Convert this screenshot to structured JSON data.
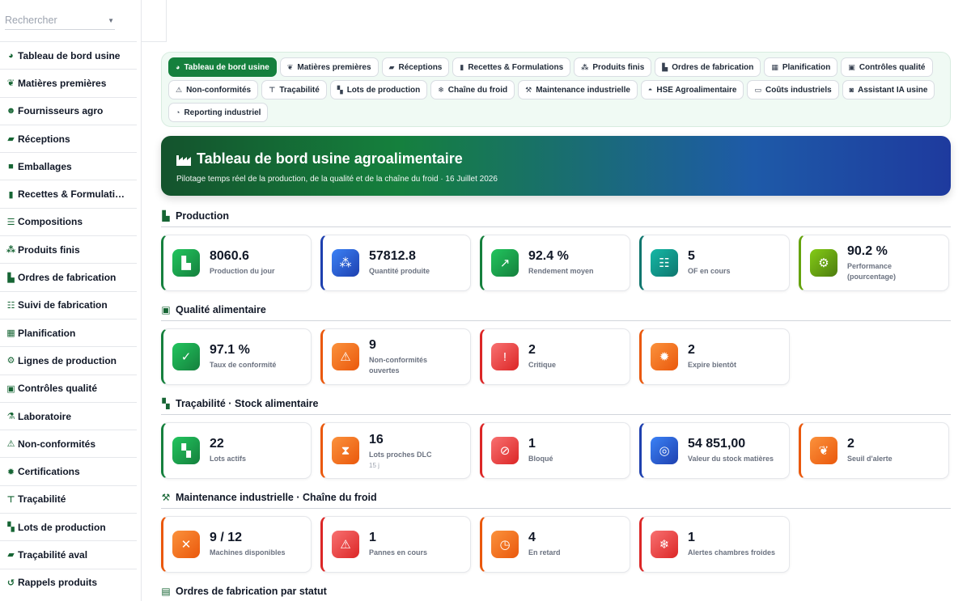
{
  "search": {
    "placeholder": "Rechercher"
  },
  "sidebar": {
    "items": [
      {
        "label": "Tableau de bord usine",
        "icon": "gauge-icon"
      },
      {
        "label": "Matières premières",
        "icon": "seedling-icon"
      },
      {
        "label": "Fournisseurs agro",
        "icon": "users-icon"
      },
      {
        "label": "Réceptions",
        "icon": "truck-icon"
      },
      {
        "label": "Emballages",
        "icon": "box-icon"
      },
      {
        "label": "Recettes & Formulati…",
        "icon": "book-icon"
      },
      {
        "label": "Compositions",
        "icon": "list-icon"
      },
      {
        "label": "Produits finis",
        "icon": "cubes-icon"
      },
      {
        "label": "Ordres de fabrication",
        "icon": "industry-icon"
      },
      {
        "label": "Suivi de fabrication",
        "icon": "list-check-icon"
      },
      {
        "label": "Planification",
        "icon": "calendar-icon"
      },
      {
        "label": "Lignes de production",
        "icon": "gears-icon"
      },
      {
        "label": "Contrôles qualité",
        "icon": "clipboard-check-icon"
      },
      {
        "label": "Laboratoire",
        "icon": "flask-icon"
      },
      {
        "label": "Non-conformités",
        "icon": "warning-icon"
      },
      {
        "label": "Certifications",
        "icon": "certificate-icon"
      },
      {
        "label": "Traçabilité",
        "icon": "sitemap-icon"
      },
      {
        "label": "Lots de production",
        "icon": "boxes-icon"
      },
      {
        "label": "Traçabilité aval",
        "icon": "truck-fast-icon"
      },
      {
        "label": "Rappels produits",
        "icon": "rotate-left-icon"
      }
    ]
  },
  "tabs": [
    {
      "label": "Tableau de bord usine",
      "active": true
    },
    {
      "label": "Matières premières"
    },
    {
      "label": "Réceptions"
    },
    {
      "label": "Recettes & Formulations"
    },
    {
      "label": "Produits finis"
    },
    {
      "label": "Ordres de fabrication"
    },
    {
      "label": "Planification"
    },
    {
      "label": "Contrôles qualité"
    },
    {
      "label": "Non-conformités"
    },
    {
      "label": "Traçabilité"
    },
    {
      "label": "Lots de production"
    },
    {
      "label": "Chaîne du froid"
    },
    {
      "label": "Maintenance industrielle"
    },
    {
      "label": "HSE Agroalimentaire"
    },
    {
      "label": "Coûts industriels"
    },
    {
      "label": "Assistant IA usine"
    },
    {
      "label": "Reporting industriel"
    }
  ],
  "hero": {
    "title": "Tableau de bord usine agroalimentaire",
    "subtitle": "Pilotage temps réel de la production, de la qualité et de la chaîne du froid · 16 Juillet 2026"
  },
  "sections": {
    "production": {
      "title": "Production",
      "cards": [
        {
          "value": "8060.6",
          "label": "Production du jour"
        },
        {
          "value": "57812.8",
          "label": "Quantité produite"
        },
        {
          "value": "92.4 %",
          "label": "Rendement moyen"
        },
        {
          "value": "5",
          "label": "OF en cours"
        },
        {
          "value": "90.2 %",
          "label": "Performance (pourcentage)"
        }
      ]
    },
    "qualite": {
      "title": "Qualité alimentaire",
      "cards": [
        {
          "value": "97.1 %",
          "label": "Taux de conformité"
        },
        {
          "value": "9",
          "label": "Non-conformités ouvertes"
        },
        {
          "value": "2",
          "label": "Critique"
        },
        {
          "value": "2",
          "label": "Expire bientôt"
        }
      ]
    },
    "tracabilite": {
      "title": "Traçabilité · Stock alimentaire",
      "cards": [
        {
          "value": "22",
          "label": "Lots actifs"
        },
        {
          "value": "16",
          "label": "Lots proches DLC",
          "extra": "15 j"
        },
        {
          "value": "1",
          "label": "Bloqué"
        },
        {
          "value": "54 851,00",
          "label": "Valeur du stock matières"
        },
        {
          "value": "2",
          "label": "Seuil d'alerte"
        }
      ]
    },
    "maintenance": {
      "title": "Maintenance industrielle · Chaîne du froid",
      "cards": [
        {
          "value": "9 / 12",
          "label": "Machines disponibles"
        },
        {
          "value": "1",
          "label": "Pannes en cours"
        },
        {
          "value": "4",
          "label": "En retard"
        },
        {
          "value": "1",
          "label": "Alertes chambres froides"
        }
      ]
    },
    "ordres": {
      "title": "Ordres de fabrication par statut"
    }
  }
}
